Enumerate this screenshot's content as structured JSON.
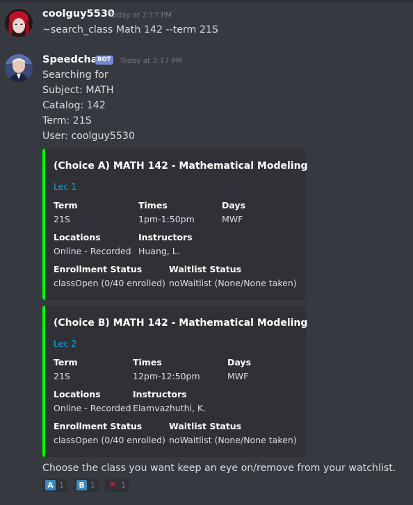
{
  "message1": {
    "username": "coolguy5530",
    "timestamp": "Today at 2:17 PM",
    "content": "~search_class Math 142 --term 21S"
  },
  "message2": {
    "username": "Speedchat",
    "bot_tag": "BOT",
    "timestamp": "Today at 2:17 PM",
    "lines": [
      "Searching for",
      "Subject: MATH",
      "Catalog: 142",
      "Term: 21S",
      "User: coolguy5530"
    ],
    "embeds": [
      {
        "accent_color": "#00ff00",
        "title": "(Choice A) MATH 142 - Mathematical Modeling",
        "link": "Lec 1",
        "fields": {
          "term_label": "Term",
          "term_value": "21S",
          "times_label": "Times",
          "times_value": "1pm-1:50pm",
          "days_label": "Days",
          "days_value": "MWF",
          "locations_label": "Locations",
          "locations_value": "Online - Recorded",
          "instructors_label": "Instructors",
          "instructors_value": "Huang, L.",
          "enrollment_label": "Enrollment Status",
          "enrollment_value": "classOpen (0/40 enrolled)",
          "waitlist_label": "Waitlist Status",
          "waitlist_value": "noWaitlist (None/None taken)"
        }
      },
      {
        "accent_color": "#00ff00",
        "title": "(Choice B) MATH 142 - Mathematical Modeling",
        "link": "Lec 2",
        "fields": {
          "term_label": "Term",
          "term_value": "21S",
          "times_label": "Times",
          "times_value": "12pm-12:50pm",
          "days_label": "Days",
          "days_value": "MWF",
          "locations_label": "Locations",
          "locations_value": "Online - Recorded",
          "instructors_label": "Instructors",
          "instructors_value": "Elamvazhuthi, K.",
          "enrollment_label": "Enrollment Status",
          "enrollment_value": "classOpen (0/40 enrolled)",
          "waitlist_label": "Waitlist Status",
          "waitlist_value": "noWaitlist (None/None taken)"
        }
      }
    ],
    "footer_text": "Choose the class you want keep an eye on/remove from your watchlist.",
    "reactions": [
      {
        "emoji": "A",
        "icon": "regional-a-icon",
        "count": "1",
        "color": "#3b88c3"
      },
      {
        "emoji": "B",
        "icon": "regional-b-icon",
        "count": "1",
        "color": "#3b88c3"
      },
      {
        "emoji": "✕",
        "icon": "red-x-icon",
        "count": "1",
        "color": "#dd2e44"
      }
    ]
  },
  "colors": {
    "background": "#36393f",
    "embed_background": "#2f3136",
    "link": "#00b0f4",
    "bot_tag": "#7289da",
    "timestamp": "#72767d"
  }
}
